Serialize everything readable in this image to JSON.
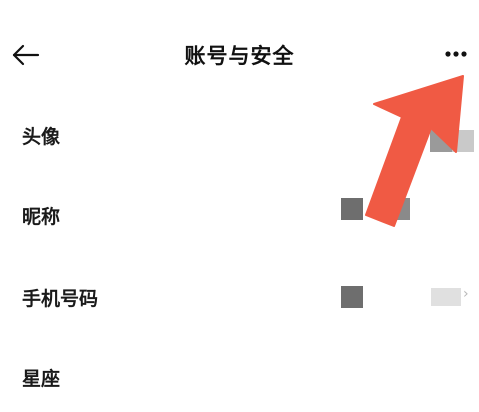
{
  "header": {
    "title": "账号与安全",
    "back_icon": "back-arrow-icon",
    "more_icon": "more-dots-icon"
  },
  "rows": [
    {
      "label": "头像"
    },
    {
      "label": "昵称"
    },
    {
      "label": "手机号码"
    },
    {
      "label": "星座"
    }
  ],
  "annotation": {
    "icon": "red-arrow-pointer-icon",
    "color": "#f05a44"
  },
  "colors": {
    "text": "#1a1a1a",
    "annotation_red": "#f05a44",
    "mosaic_dark": "#6e6e6e",
    "mosaic_mid": "#9a9a9a",
    "mosaic_light": "#dcdcdc"
  }
}
